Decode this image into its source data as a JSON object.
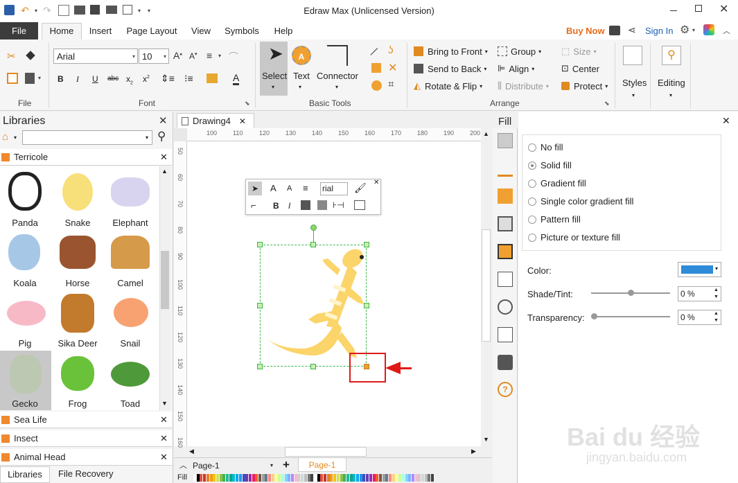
{
  "app": {
    "title": "Edraw Max (Unlicensed Version)"
  },
  "menu": {
    "file": "File",
    "tabs": [
      "Home",
      "Insert",
      "Page Layout",
      "View",
      "Symbols",
      "Help"
    ],
    "buy_now": "Buy Now",
    "sign_in": "Sign In"
  },
  "font": {
    "name": "Arial",
    "size": "10"
  },
  "tools": {
    "select": "Select",
    "text": "Text",
    "connector": "Connector"
  },
  "arrange": {
    "bring_front": "Bring to Front",
    "send_back": "Send to Back",
    "rotate_flip": "Rotate & Flip",
    "group": "Group",
    "align": "Align",
    "distribute": "Distribute",
    "size": "Size",
    "center": "Center",
    "protect": "Protect"
  },
  "styles": "Styles",
  "editing": "Editing",
  "groups": {
    "file": "File",
    "font": "Font",
    "basic_tools": "Basic Tools",
    "arrange": "Arrange"
  },
  "libraries": {
    "title": "Libraries",
    "category": "Terricole",
    "items": [
      "Panda",
      "Snake",
      "Elephant",
      "Koala",
      "Horse",
      "Camel",
      "Pig",
      "Sika Deer",
      "Snail",
      "Gecko",
      "Frog",
      "Toad"
    ],
    "other_categories": [
      "Sea Life",
      "Insect",
      "Animal Head"
    ]
  },
  "doc_tab": "Drawing4",
  "ruler": {
    "h": [
      "100",
      "110",
      "120",
      "130",
      "140",
      "150",
      "160",
      "170",
      "180",
      "190",
      "200"
    ],
    "v": [
      "50",
      "60",
      "70",
      "80",
      "90",
      "100",
      "110",
      "120",
      "130",
      "140",
      "150",
      "160"
    ]
  },
  "mini_toolbar": {
    "font": "rial"
  },
  "fill_panel": {
    "title": "Fill",
    "options": [
      "No fill",
      "Solid fill",
      "Gradient fill",
      "Single color gradient fill",
      "Pattern fill",
      "Picture or texture fill"
    ],
    "color_label": "Color:",
    "shade_label": "Shade/Tint:",
    "transparency_label": "Transparency:",
    "shade_value": "0 %",
    "transparency_value": "0 %",
    "color": "#2e8bd8"
  },
  "bottom": {
    "page_select": "Page-1",
    "page_tab": "Page-1",
    "fill_label": "Fill",
    "tab_libraries": "Libraries",
    "tab_file_recovery": "File Recovery"
  },
  "watermark": {
    "main": "Bai du 经验",
    "sub": "jingyan.baidu.com"
  }
}
